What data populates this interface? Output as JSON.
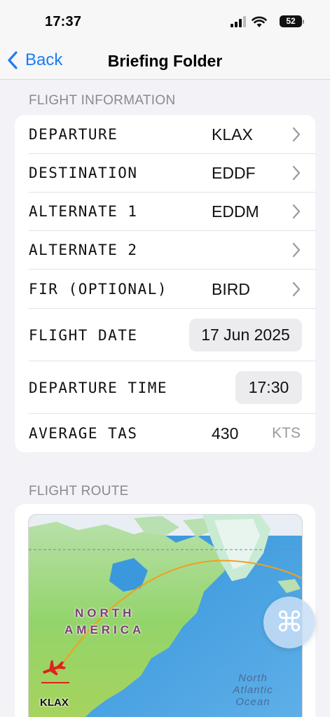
{
  "status_bar": {
    "time": "17:37",
    "battery": "52"
  },
  "nav": {
    "back_label": "Back",
    "title": "Briefing Folder"
  },
  "flight_info": {
    "header": "FLIGHT INFORMATION",
    "rows": [
      {
        "label": "DEPARTURE",
        "value": "KLAX"
      },
      {
        "label": "DESTINATION",
        "value": "EDDF"
      },
      {
        "label": "ALTERNATE 1",
        "value": "EDDM"
      },
      {
        "label": "ALTERNATE 2",
        "value": ""
      },
      {
        "label": "FIR (OPTIONAL)",
        "value": "BIRD"
      }
    ],
    "flight_date": {
      "label": "FLIGHT DATE",
      "value": "17 Jun 2025"
    },
    "departure_time": {
      "label": "DEPARTURE TIME",
      "value": "17:30"
    },
    "average_tas": {
      "label": "AVERAGE TAS",
      "value": "430",
      "unit": "KTS"
    }
  },
  "flight_route": {
    "header": "FLIGHT ROUTE",
    "map": {
      "continent_line1": "NORTH",
      "continent_line2": "AMERICA",
      "ocean_line1": "North",
      "ocean_line2": "Atlantic",
      "ocean_line3": "Ocean",
      "airport_label": "KLAX"
    },
    "command_icon": "⌘"
  },
  "colors": {
    "accent": "#1a7cf5",
    "route": "#f0a020",
    "plane": "#e02020"
  }
}
